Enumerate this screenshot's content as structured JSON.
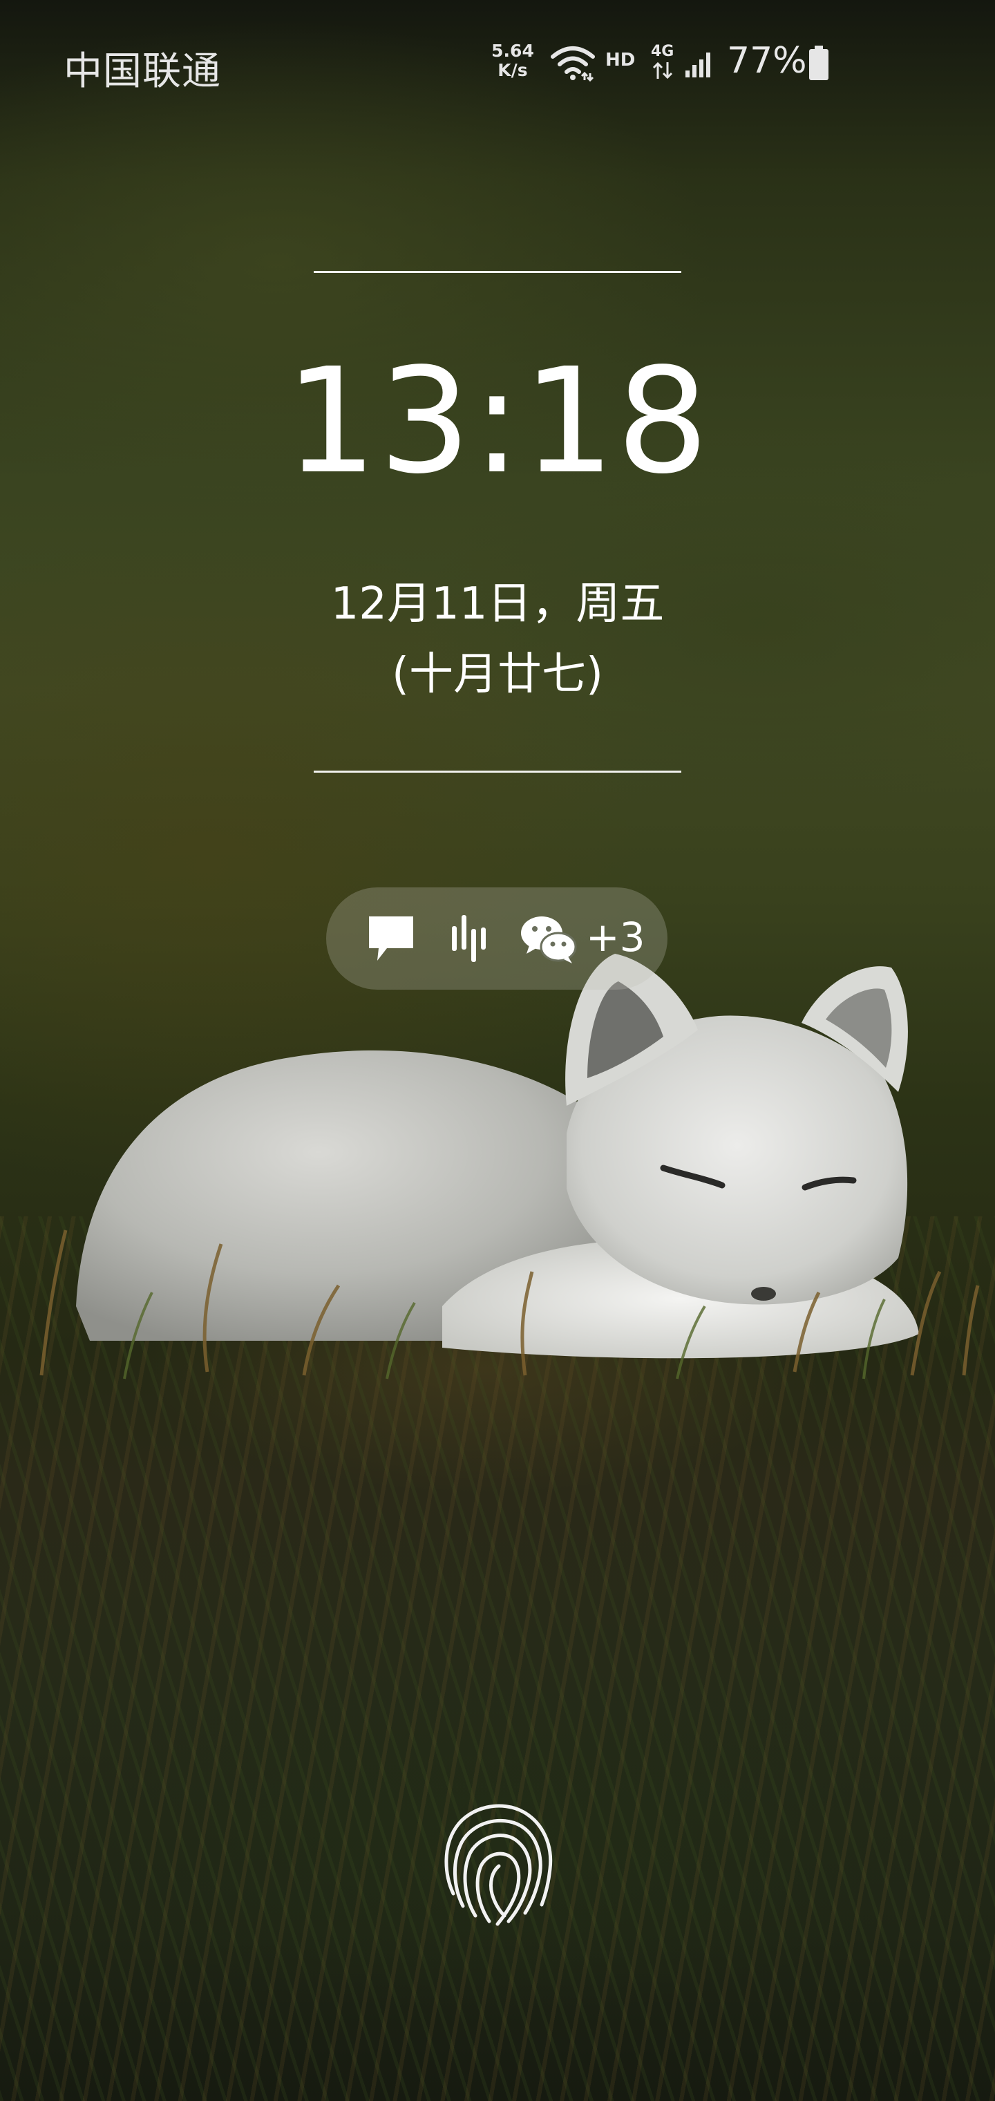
{
  "status_bar": {
    "carrier": "中国联通",
    "net_speed_value": "5.64",
    "net_speed_unit": "K/s",
    "hd_label": "HD",
    "network_type": "4G",
    "battery_percent": "77%",
    "icons": [
      "wifi-icon",
      "signal-icon",
      "battery-icon"
    ]
  },
  "lock_screen": {
    "time": "13:18",
    "date": "12月11日，周五",
    "lunar_date": "(十月廿七)"
  },
  "notifications": {
    "icons": [
      "message-icon",
      "voice-wave-icon",
      "wechat-icon"
    ],
    "more_count": "+3"
  },
  "unlock": {
    "icon": "fingerprint-icon"
  },
  "wallpaper": {
    "subject": "arctic-fox",
    "colors": {
      "background_dark": "#1b1f12",
      "background_olive": "#404822",
      "fox_fur": "#d2d2ce"
    }
  }
}
